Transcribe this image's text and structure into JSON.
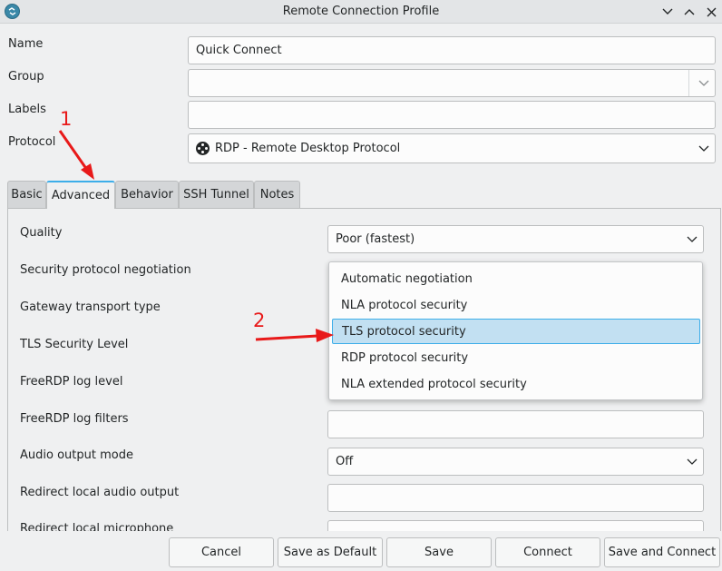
{
  "window": {
    "title": "Remote Connection Profile",
    "controls": [
      "minimize",
      "maximize",
      "close"
    ]
  },
  "form": {
    "name_label": "Name",
    "name_value": "Quick Connect",
    "group_label": "Group",
    "group_value": "",
    "labels_label": "Labels",
    "labels_value": "",
    "protocol_label": "Protocol",
    "protocol_value": "RDP - Remote Desktop Protocol"
  },
  "tabs": [
    {
      "label": "Basic"
    },
    {
      "label": "Advanced",
      "active": true
    },
    {
      "label": "Behavior"
    },
    {
      "label": "SSH Tunnel"
    },
    {
      "label": "Notes"
    }
  ],
  "advanced": {
    "quality_label": "Quality",
    "quality_value": "Poor (fastest)",
    "security_label": "Security protocol negotiation",
    "gateway_label": "Gateway transport type",
    "tls_label": "TLS Security Level",
    "log_level_label": "FreeRDP log level",
    "log_filters_label": "FreeRDP log filters",
    "log_filters_value": "",
    "audio_label": "Audio output mode",
    "audio_value": "Off",
    "redirect_audio_label": "Redirect local audio output",
    "redirect_audio_value": "",
    "redirect_mic_label": "Redirect local microphone"
  },
  "security_dropdown": {
    "options": [
      "Automatic negotiation",
      "NLA protocol security",
      "TLS protocol security",
      "RDP protocol security",
      "NLA extended protocol security"
    ],
    "selected": "TLS protocol security"
  },
  "buttons": {
    "cancel": "Cancel",
    "save_default": "Save as Default",
    "save": "Save",
    "connect": "Connect",
    "save_connect": "Save and Connect"
  },
  "annotations": {
    "marker_1": "1",
    "marker_2": "2"
  },
  "colors": {
    "accent": "#3daee9",
    "selection": "#c2e0f2",
    "annotation": "#e81919"
  }
}
